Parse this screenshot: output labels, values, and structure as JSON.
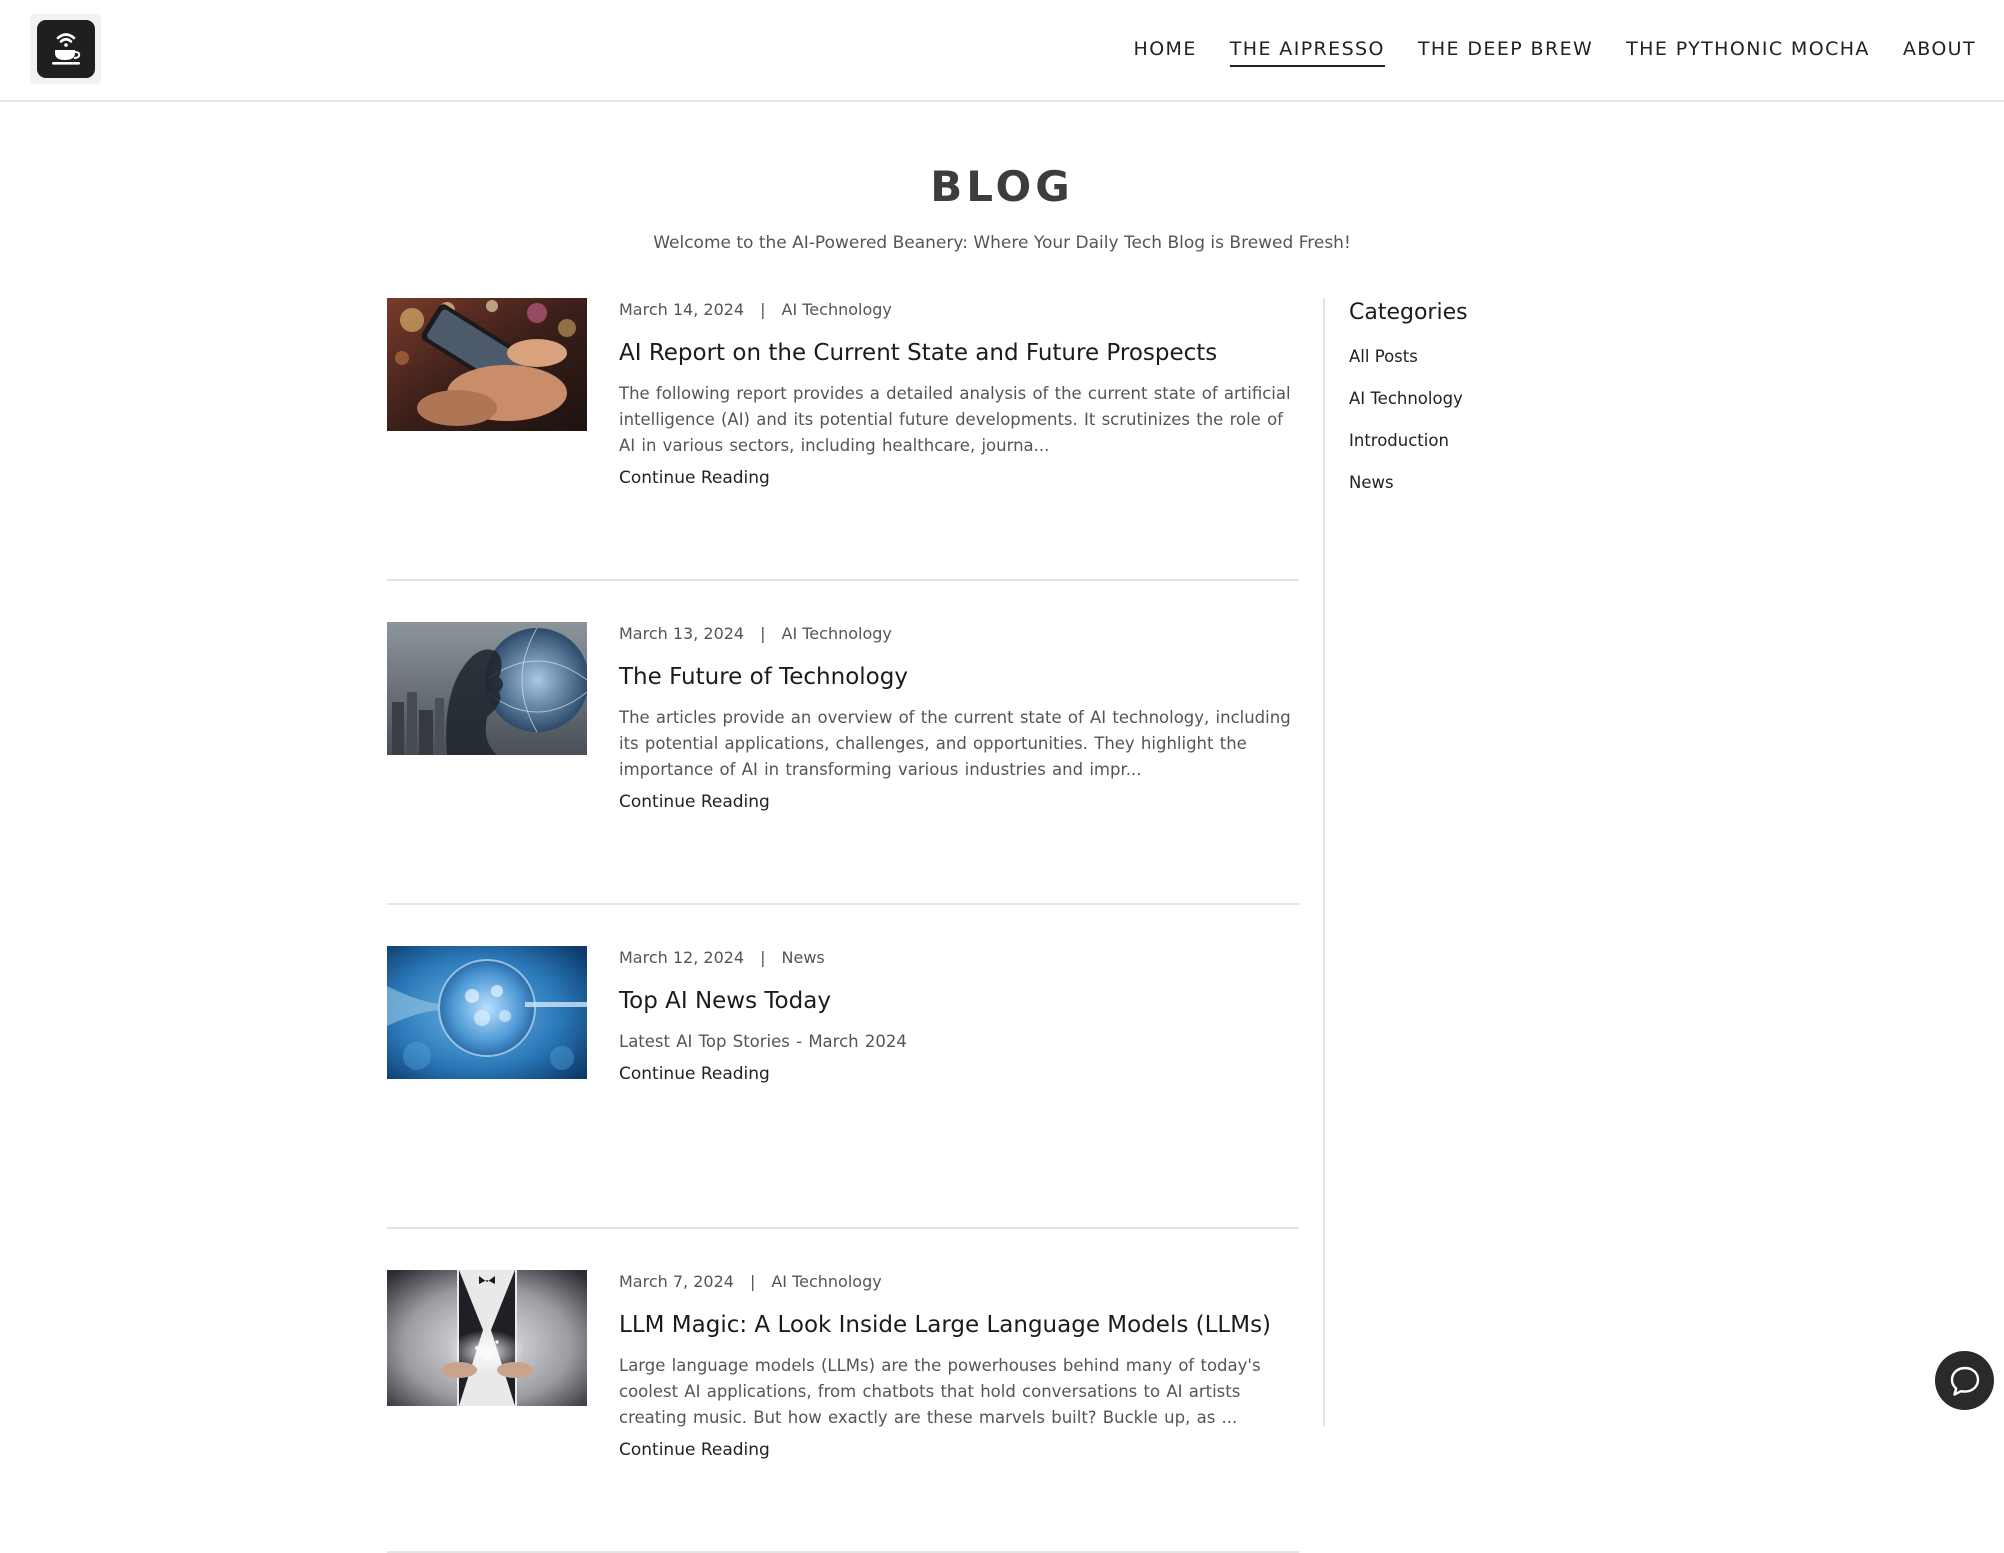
{
  "header": {
    "nav": [
      {
        "label": "HOME",
        "active": false
      },
      {
        "label": "THE AIPRESSO",
        "active": true
      },
      {
        "label": "THE DEEP BREW",
        "active": false
      },
      {
        "label": "THE PYTHONIC MOCHA",
        "active": false
      },
      {
        "label": "ABOUT",
        "active": false
      }
    ]
  },
  "page": {
    "title": "BLOG",
    "subtitle": "Welcome to the AI-Powered Beanery: Where Your Daily Tech Blog is Brewed Fresh!"
  },
  "posts": [
    {
      "date": "March 14, 2024",
      "separator": "|",
      "category": "AI Technology",
      "title": "AI Report on the Current State and Future Prospects",
      "excerpt": "The following report provides a detailed analysis of the current state of artificial intelligence (AI) and its potential future developments. It scrutinizes the role of AI in various sectors, including healthcare, journa...",
      "cta": "Continue Reading",
      "image": "hands-holding-smartphone-bokeh"
    },
    {
      "date": "March 13, 2024",
      "separator": "|",
      "category": "AI Technology",
      "title": "The Future of Technology",
      "excerpt": "The articles provide an overview of the current state of AI technology, including its potential applications, challenges, and opportunities. They highlight the importance of AI in transforming various industries and impr...",
      "cta": "Continue Reading",
      "image": "silhouette-globe-city"
    },
    {
      "date": "March 12, 2024",
      "separator": "|",
      "category": "News",
      "title": "Top AI News Today",
      "excerpt": "Latest AI Top Stories - March 2024",
      "cta": "Continue Reading",
      "image": "blue-cell-microscope"
    },
    {
      "date": "March 7, 2024",
      "separator": "|",
      "category": "AI Technology",
      "title": "LLM Magic: A Look Inside Large Language Models (LLMs)",
      "excerpt": "Large language models (LLMs) are the powerhouses behind many of today's coolest AI applications, from chatbots that hold conversations to AI artists creating music. But how exactly are these marvels built? Buckle up, as ...",
      "cta": "Continue Reading",
      "image": "magician-glowing-hands"
    }
  ],
  "sidebar": {
    "heading": "Categories",
    "categories": [
      "All Posts",
      "AI Technology",
      "Introduction",
      "News"
    ]
  },
  "icons": {
    "logo": "coffee-cup-wifi-icon",
    "chat": "chat-bubble-icon"
  },
  "colors": {
    "text": "#222222",
    "muted": "#555555",
    "title": "#3d3d3d",
    "divider": "#e4e4e4",
    "logo_bg": "#1f1f1f",
    "chat_bg": "#2a2a2a"
  }
}
